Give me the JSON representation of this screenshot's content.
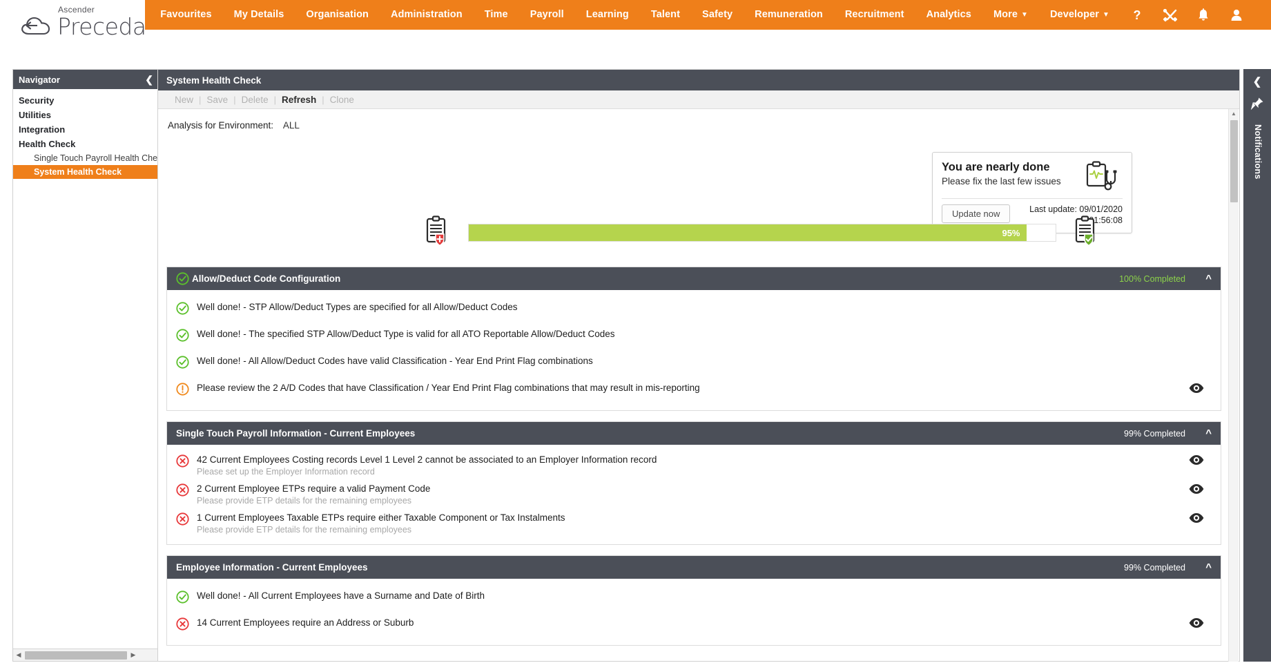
{
  "brand": {
    "eyebrow": "Ascender",
    "name": "Preceda",
    "accent": "#ef7f1a"
  },
  "topnav": {
    "items": [
      {
        "label": "Favourites",
        "caret": false
      },
      {
        "label": "My Details",
        "caret": false
      },
      {
        "label": "Organisation",
        "caret": false
      },
      {
        "label": "Administration",
        "caret": false
      },
      {
        "label": "Time",
        "caret": false
      },
      {
        "label": "Payroll",
        "caret": false
      },
      {
        "label": "Learning",
        "caret": false
      },
      {
        "label": "Talent",
        "caret": false
      },
      {
        "label": "Safety",
        "caret": false
      },
      {
        "label": "Remuneration",
        "caret": false
      },
      {
        "label": "Recruitment",
        "caret": false
      },
      {
        "label": "Analytics",
        "caret": false
      },
      {
        "label": "More",
        "caret": true
      },
      {
        "label": "Developer",
        "caret": true
      }
    ],
    "icons": [
      "help-icon",
      "tools-icon",
      "bell-icon",
      "user-icon"
    ]
  },
  "navigator": {
    "title": "Navigator",
    "collapse_icon": "chevron-left-icon",
    "roots": [
      "Security",
      "Utilities",
      "Integration",
      "Health Check"
    ],
    "children": [
      {
        "label": "Single Touch Payroll Health Check",
        "selected": false
      },
      {
        "label": "System Health Check",
        "selected": true
      }
    ]
  },
  "main": {
    "title": "System Health Check",
    "toolbar": [
      {
        "label": "New",
        "enabled": false
      },
      {
        "label": "Save",
        "enabled": false
      },
      {
        "label": "Delete",
        "enabled": false
      },
      {
        "label": "Refresh",
        "enabled": true
      },
      {
        "label": "Clone",
        "enabled": false
      }
    ],
    "environment_label": "Analysis for Environment:",
    "environment_value": "ALL"
  },
  "callout": {
    "title": "You are nearly done",
    "subtitle": "Please fix the last few issues",
    "button": "Update now",
    "last_update_label": "Last update: 09/01/2020",
    "last_update_time": "01:56:08",
    "art_icon": "clipboard-stethoscope-icon"
  },
  "progress": {
    "percent_label": "95%",
    "percent_value": 95,
    "fill_color": "#b5d44d",
    "left_icon": "clipboard-alert-icon",
    "right_icon": "clipboard-ok-icon"
  },
  "sections": [
    {
      "title": "Allow/Deduct Code Configuration",
      "completed": "100% Completed",
      "completed_tone": "green",
      "status_icon": "check-circle-icon",
      "has_status_icon": true,
      "chevron": "chevron-up-icon",
      "rows": [
        {
          "icon": "check-circle-icon",
          "main": "Well done! - STP Allow/Deduct Types are specified for all Allow/Deduct Codes",
          "sub": "",
          "eye": false
        },
        {
          "icon": "check-circle-icon",
          "main": "Well done! - The specified STP Allow/Deduct Type is valid for all ATO Reportable Allow/Deduct Codes",
          "sub": "",
          "eye": false
        },
        {
          "icon": "check-circle-icon",
          "main": "Well done! - All Allow/Deduct Codes have valid Classification - Year End Print Flag combinations",
          "sub": "",
          "eye": false
        },
        {
          "icon": "warning-circle-icon",
          "main": "Please review the 2 A/D Codes that have Classification / Year End Print Flag combinations that may result in mis-reporting",
          "sub": "",
          "eye": true
        }
      ]
    },
    {
      "title": "Single Touch Payroll Information - Current Employees",
      "completed": "99% Completed",
      "completed_tone": "white",
      "status_icon": "",
      "has_status_icon": false,
      "chevron": "chevron-up-icon",
      "rows": [
        {
          "icon": "error-circle-icon",
          "main": "42 Current Employees Costing records Level 1 Level 2 cannot be associated to an Employer Information record",
          "sub": "Please set up the Employer Information record",
          "eye": true
        },
        {
          "icon": "error-circle-icon",
          "main": "2 Current Employee ETPs require a valid Payment Code",
          "sub": "Please provide ETP details for the remaining employees",
          "eye": true
        },
        {
          "icon": "error-circle-icon",
          "main": "1 Current Employees Taxable ETPs require either Taxable Component or Tax Instalments",
          "sub": "Please provide ETP details for the remaining employees",
          "eye": true
        }
      ]
    },
    {
      "title": "Employee Information - Current Employees",
      "completed": "99% Completed",
      "completed_tone": "white",
      "status_icon": "",
      "has_status_icon": false,
      "chevron": "chevron-up-icon",
      "rows": [
        {
          "icon": "check-circle-icon",
          "main": "Well done! - All Current Employees have a Surname and Date of Birth",
          "sub": "",
          "eye": false
        },
        {
          "icon": "error-circle-icon",
          "main": "14 Current Employees require an Address or Suburb",
          "sub": "",
          "eye": true
        }
      ]
    }
  ],
  "rail": {
    "collapse_icon": "chevron-left-icon",
    "pin_icon": "pin-icon",
    "label": "Notifications"
  }
}
